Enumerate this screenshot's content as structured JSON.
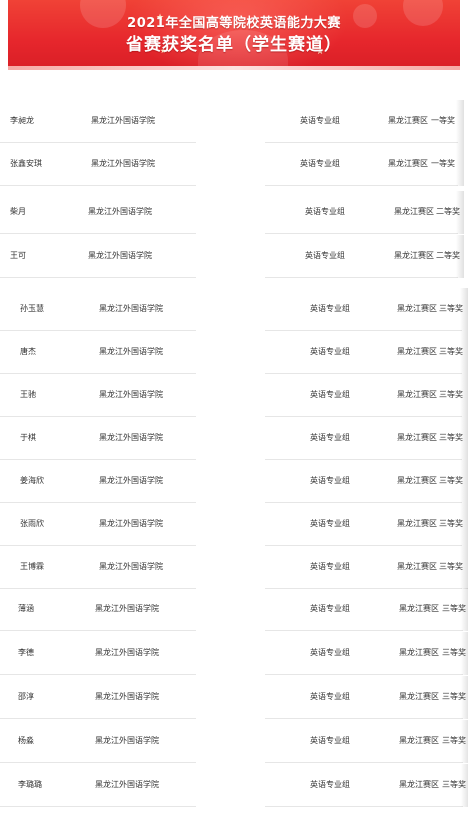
{
  "header": {
    "title": "2021年全国高等院校英语能力大赛",
    "subtitle": "省赛获奖名单（学生赛道）"
  },
  "rows": [
    {
      "name": "李昶龙",
      "school": "黑龙江外国语学院",
      "group": "英语专业组",
      "region": "黑龙江赛区",
      "award": "一等奖"
    },
    {
      "name": "张鑫安琪",
      "school": "黑龙江外国语学院",
      "group": "英语专业组",
      "region": "黑龙江赛区",
      "award": "一等奖"
    },
    {
      "name": "柴月",
      "school": "黑龙江外国语学院",
      "group": "英语专业组",
      "region": "黑龙江赛区",
      "award": "二等奖"
    },
    {
      "name": "王可",
      "school": "黑龙江外国语学院",
      "group": "英语专业组",
      "region": "黑龙江赛区",
      "award": "二等奖"
    },
    {
      "name": "孙玉慧",
      "school": "黑龙江外国语学院",
      "group": "英语专业组",
      "region": "黑龙江赛区",
      "award": "三等奖"
    },
    {
      "name": "唐杰",
      "school": "黑龙江外国语学院",
      "group": "英语专业组",
      "region": "黑龙江赛区",
      "award": "三等奖"
    },
    {
      "name": "王驰",
      "school": "黑龙江外国语学院",
      "group": "英语专业组",
      "region": "黑龙江赛区",
      "award": "三等奖"
    },
    {
      "name": "于棋",
      "school": "黑龙江外国语学院",
      "group": "英语专业组",
      "region": "黑龙江赛区",
      "award": "三等奖"
    },
    {
      "name": "姜海欣",
      "school": "黑龙江外国语学院",
      "group": "英语专业组",
      "region": "黑龙江赛区",
      "award": "三等奖"
    },
    {
      "name": "张雨欣",
      "school": "黑龙江外国语学院",
      "group": "英语专业组",
      "region": "黑龙江赛区",
      "award": "三等奖"
    },
    {
      "name": "王博霖",
      "school": "黑龙江外国语学院",
      "group": "英语专业组",
      "region": "黑龙江赛区",
      "award": "三等奖"
    },
    {
      "name": "薄涵",
      "school": "黑龙江外国语学院",
      "group": "英语专业组",
      "region": "黑龙江赛区",
      "award": "三等奖"
    },
    {
      "name": "李德",
      "school": "黑龙江外国语学院",
      "group": "英语专业组",
      "region": "黑龙江赛区",
      "award": "三等奖"
    },
    {
      "name": "邵淳",
      "school": "黑龙江外国语学院",
      "group": "英语专业组",
      "region": "黑龙江赛区",
      "award": "三等奖"
    },
    {
      "name": "杨淼",
      "school": "黑龙江外国语学院",
      "group": "英语专业组",
      "region": "黑龙江赛区",
      "award": "三等奖"
    },
    {
      "name": "李璐璐",
      "school": "黑龙江外国语学院",
      "group": "英语专业组",
      "region": "黑龙江赛区",
      "award": "三等奖"
    }
  ]
}
